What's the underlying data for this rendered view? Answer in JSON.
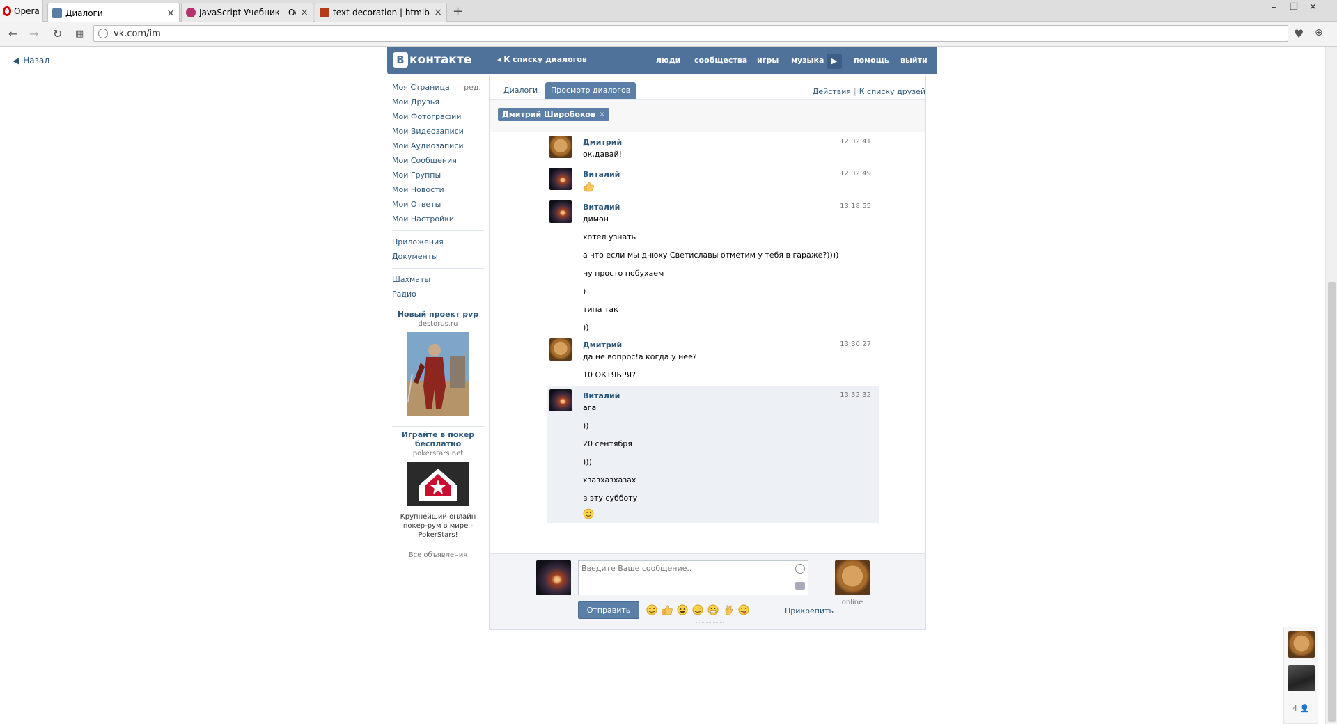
{
  "browser": {
    "opera_label": "Opera",
    "tabs": [
      {
        "title": "Диалоги",
        "active": true,
        "favicon_color": "#597da3"
      },
      {
        "title": "JavaScript Учебник - Осн",
        "active": false,
        "favicon_color": "#b5306e"
      },
      {
        "title": "text-decoration | htmlbook",
        "active": false,
        "favicon_color": "#b53a1a"
      }
    ],
    "new_tab": "+",
    "url": "vk.com/im"
  },
  "page": {
    "back_label": "Назад"
  },
  "vk_header": {
    "logo_b": "В",
    "logo_text": "контакте",
    "back_to_list": "К списку диалогов",
    "nav": [
      "люди",
      "сообщества",
      "игры",
      "музыка",
      "помощь",
      "выйти"
    ]
  },
  "left_menu": {
    "edit_label": "ред.",
    "group1": [
      "Моя Страница",
      "Мои Друзья",
      "Мои Фотографии",
      "Мои Видеозаписи",
      "Мои Аудиозаписи",
      "Мои Сообщения",
      "Мои Группы",
      "Мои Новости",
      "Мои Ответы",
      "Мои Настройки"
    ],
    "group2": [
      "Приложения",
      "Документы"
    ],
    "group3": [
      "Шахматы",
      "Радио"
    ],
    "ads": [
      {
        "title": "Новый проект pvp",
        "domain": "destorus.ru"
      },
      {
        "title": "Играйте в покер бесплатно",
        "domain": "pokerstars.net",
        "text": "Крупнейший онлайн покер-рум в мире - PokerStars!"
      }
    ],
    "all_ads": "Все объявления"
  },
  "im": {
    "tabs": [
      "Диалоги",
      "Просмотр диалогов"
    ],
    "actions": "Действия",
    "friends_list": "К списку друзей",
    "peer_chip": "Дмитрий Широбоков",
    "messages": [
      {
        "author": "Дмитрий",
        "time": "12:02:41",
        "lines": [
          "ок,давай!"
        ]
      },
      {
        "author": "Виталий",
        "time": "12:02:49",
        "lines": [],
        "emoji": "thumbs-up"
      },
      {
        "author": "Виталий",
        "time": "13:18:55",
        "lines": [
          "димон",
          "хотел узнать",
          "а что если мы днюху Светиславы отметим у тебя в гараже?))))",
          "ну просто побухаем",
          ")",
          "типа так",
          "))"
        ]
      },
      {
        "author": "Дмитрий",
        "time": "13:30:27",
        "lines": [
          "да не вопрос!а когда у неё?",
          "10 ОКТЯБРЯ?"
        ]
      },
      {
        "author": "Виталий",
        "time": "13:32:32",
        "lines": [
          "ага",
          "))",
          "20 сентября",
          ")))",
          "хзазхазхазах",
          "в эту субботу"
        ],
        "emoji": "wink",
        "highlighted": true
      }
    ],
    "compose": {
      "placeholder": "Введите Ваше сообщение..",
      "send": "Отправить",
      "attach": "Прикрепить",
      "online": "online"
    }
  },
  "side_friends": {
    "count": "4"
  },
  "colors": {
    "vk_blue": "#4e729a",
    "link": "#2b587a",
    "highlight": "#edf1f5"
  }
}
